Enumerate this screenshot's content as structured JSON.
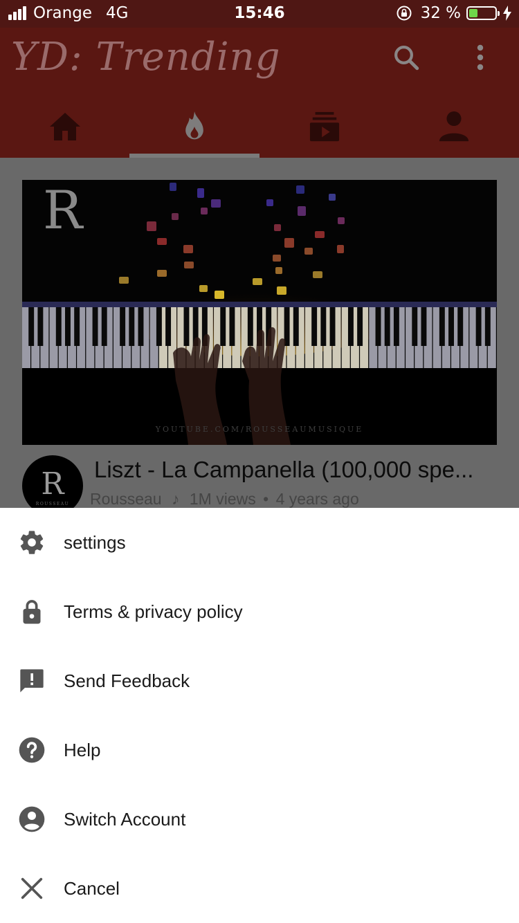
{
  "status_bar": {
    "carrier": "Orange",
    "network": "4G",
    "time": "15:46",
    "battery_percent": "32 %",
    "battery_level": 0.32,
    "battery_color": "#6fd64a"
  },
  "header": {
    "brand": "YD: Trending",
    "brand_color": "#5a1712",
    "icons": [
      "search-icon",
      "more-vert-icon"
    ]
  },
  "tabs": [
    {
      "name": "home",
      "icon": "home-icon",
      "active": false
    },
    {
      "name": "trending",
      "icon": "fire-icon",
      "active": true
    },
    {
      "name": "subscriptions",
      "icon": "subscriptions-icon",
      "active": false
    },
    {
      "name": "account",
      "icon": "person-icon",
      "active": false
    }
  ],
  "video": {
    "title": "Liszt - La Campanella (100,000 spe...",
    "channel": "Rousseau",
    "separator_note": "♪",
    "views": "1M views",
    "dot": "•",
    "age": "4 years ago",
    "watermark": "YOUTUBE.COM/ROUSSEAUMUSIQUE",
    "logo_letter": "R",
    "avatar_caption": "ROUSSEAU"
  },
  "menu": {
    "settings": "settings",
    "terms": "Terms & privacy policy",
    "feedback": "Send Feedback",
    "help": "Help",
    "switch_account": "Switch Account",
    "cancel": "Cancel"
  }
}
